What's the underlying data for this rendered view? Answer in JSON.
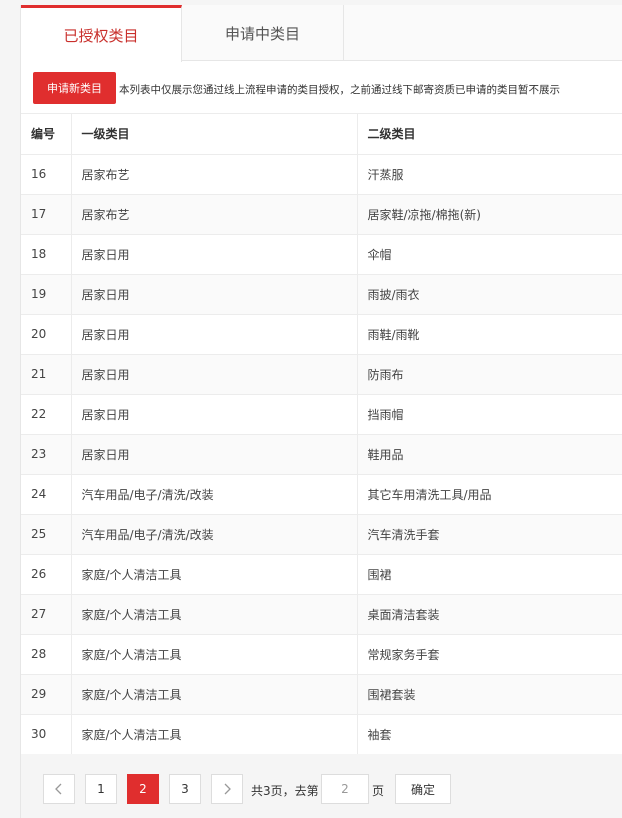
{
  "tabs": [
    {
      "label": "已授权类目",
      "active": true
    },
    {
      "label": "申请中类目",
      "active": false
    }
  ],
  "toolbar": {
    "apply_label": "申请新类目",
    "notice": "本列表中仅展示您通过线上流程申请的类目授权，之前通过线下邮寄资质已申请的类目暂不展示"
  },
  "table": {
    "headers": [
      "编号",
      "一级类目",
      "二级类目"
    ],
    "rows": [
      [
        "16",
        "居家布艺",
        "汗蒸服"
      ],
      [
        "17",
        "居家布艺",
        "居家鞋/凉拖/棉拖(新)"
      ],
      [
        "18",
        "居家日用",
        "伞帽"
      ],
      [
        "19",
        "居家日用",
        "雨披/雨衣"
      ],
      [
        "20",
        "居家日用",
        "雨鞋/雨靴"
      ],
      [
        "21",
        "居家日用",
        "防雨布"
      ],
      [
        "22",
        "居家日用",
        "挡雨帽"
      ],
      [
        "23",
        "居家日用",
        "鞋用品"
      ],
      [
        "24",
        "汽车用品/电子/清洗/改装",
        "其它车用清洗工具/用品"
      ],
      [
        "25",
        "汽车用品/电子/清洗/改装",
        "汽车清洗手套"
      ],
      [
        "26",
        "家庭/个人清洁工具",
        "围裙"
      ],
      [
        "27",
        "家庭/个人清洁工具",
        "桌面清洁套装"
      ],
      [
        "28",
        "家庭/个人清洁工具",
        "常规家务手套"
      ],
      [
        "29",
        "家庭/个人清洁工具",
        "围裙套装"
      ],
      [
        "30",
        "家庭/个人清洁工具",
        "袖套"
      ]
    ]
  },
  "pagination": {
    "pages": [
      "1",
      "2",
      "3"
    ],
    "current": "2",
    "total_text": "共3页，去第",
    "goto_value": "2",
    "page_suffix": "页",
    "confirm_label": "确定",
    "prev_icon": "chevron-left-icon",
    "next_icon": "chevron-right-icon"
  },
  "colors": {
    "accent": "#e02e2e",
    "active_tab_text": "#c9302c"
  }
}
